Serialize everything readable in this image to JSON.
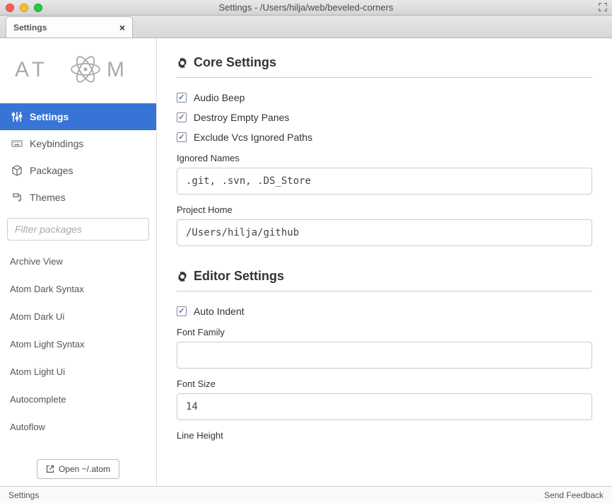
{
  "window": {
    "title": "Settings - /Users/hilja/web/beveled-corners"
  },
  "tab": {
    "label": "Settings"
  },
  "sidebar": {
    "nav": [
      {
        "label": "Settings",
        "icon": "sliders-icon",
        "active": true
      },
      {
        "label": "Keybindings",
        "icon": "keyboard-icon",
        "active": false
      },
      {
        "label": "Packages",
        "icon": "package-icon",
        "active": false
      },
      {
        "label": "Themes",
        "icon": "paint-icon",
        "active": false
      }
    ],
    "filter_placeholder": "Filter packages",
    "packages": [
      "Archive View",
      "Atom Dark Syntax",
      "Atom Dark Ui",
      "Atom Light Syntax",
      "Atom Light Ui",
      "Autocomplete",
      "Autoflow"
    ],
    "open_atom_label": "Open ~/.atom"
  },
  "core": {
    "heading": "Core Settings",
    "audio_beep_label": "Audio Beep",
    "destroy_empty_label": "Destroy Empty Panes",
    "exclude_vcs_label": "Exclude Vcs Ignored Paths",
    "ignored_names_label": "Ignored Names",
    "ignored_names_value": ".git, .svn, .DS_Store",
    "project_home_label": "Project Home",
    "project_home_value": "/Users/hilja/github"
  },
  "editor": {
    "heading": "Editor Settings",
    "auto_indent_label": "Auto Indent",
    "font_family_label": "Font Family",
    "font_family_value": "",
    "font_size_label": "Font Size",
    "font_size_value": "14",
    "line_height_label": "Line Height"
  },
  "statusbar": {
    "left": "Settings",
    "right": "Send Feedback"
  }
}
